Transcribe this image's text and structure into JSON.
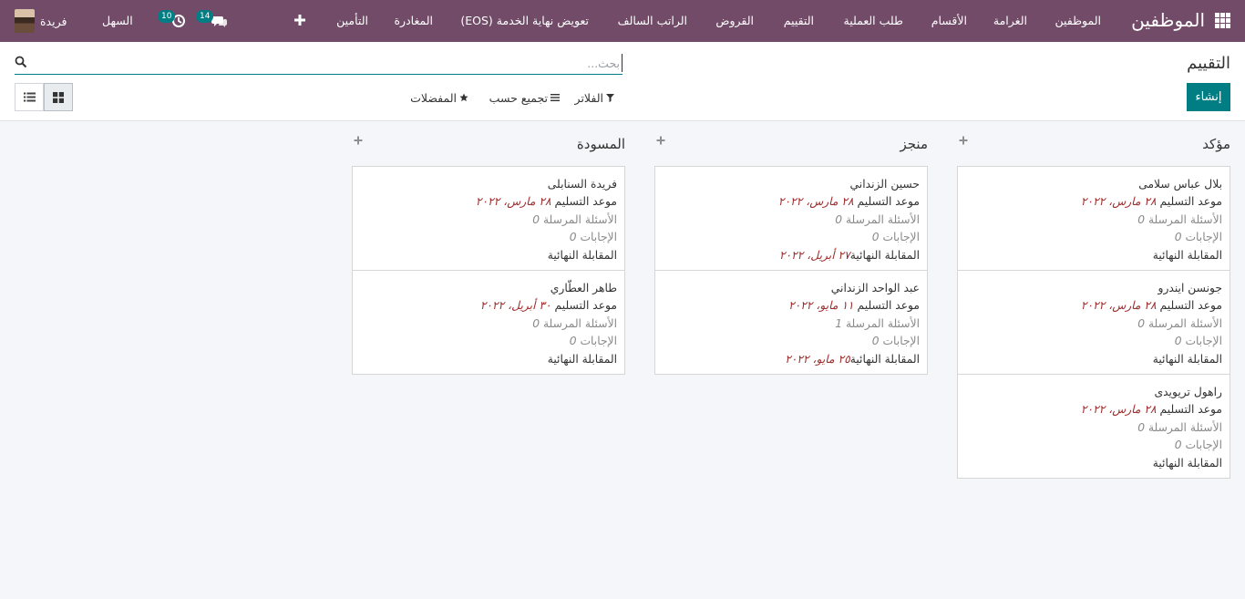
{
  "navbar": {
    "brand": "الموظفين",
    "menu": [
      {
        "label": "الموظفين"
      },
      {
        "label": "الغرامة"
      },
      {
        "label": "الأقسام"
      },
      {
        "label": "طلب العملية"
      },
      {
        "label": "التقييم"
      },
      {
        "label": "القروض"
      },
      {
        "label": "الراتب السالف"
      },
      {
        "label": "تعويض نهاية الخدمة (EOS)"
      },
      {
        "label": "المغادرة"
      },
      {
        "label": "التأمين"
      }
    ],
    "company": "السهل",
    "user_name": "فريدة",
    "messages_count": "14",
    "activities_count": "10",
    "accent_color": "#714b67"
  },
  "control_panel": {
    "breadcrumb": "التقييم",
    "create_label": "إنشاء",
    "search_placeholder": "بحث...",
    "filters_label": "الفلاتر",
    "group_by_label": "تجميع حسب",
    "favorites_label": "المفضلات",
    "primary_color": "#017e84"
  },
  "kanban": {
    "labels": {
      "deadline": "موعد التسليم",
      "questions_sent": "الأسئلة المرسلة",
      "answers": "الإجابات",
      "final_interview": "المقابلة النهائية"
    },
    "columns": [
      {
        "title": "مؤكد",
        "cards": [
          {
            "name": "بلال عباس سلامى",
            "deadline": "٢٨ مارس، ٢٠٢٢",
            "questions_sent": "0",
            "answers": "0",
            "final_interview": ""
          },
          {
            "name": "جونسن ايندرو",
            "deadline": "٢٨ مارس، ٢٠٢٢",
            "questions_sent": "0",
            "answers": "0",
            "final_interview": ""
          },
          {
            "name": "راهول تريويدى",
            "deadline": "٢٨ مارس، ٢٠٢٢",
            "questions_sent": "0",
            "answers": "0",
            "final_interview": ""
          }
        ]
      },
      {
        "title": "منجز",
        "cards": [
          {
            "name": "حسين الزنداني",
            "deadline": "٢٨ مارس، ٢٠٢٢",
            "questions_sent": "0",
            "answers": "0",
            "final_interview": "٢٧ أبريل، ٢٠٢٢"
          },
          {
            "name": "عبد الواحد الزنداني",
            "deadline": "١١ مايو، ٢٠٢٢",
            "questions_sent": "1",
            "answers": "0",
            "final_interview": "٢٥ مايو، ٢٠٢٢"
          }
        ]
      },
      {
        "title": "المسودة",
        "cards": [
          {
            "name": "فريدة السنابلى",
            "deadline": "٢٨ مارس، ٢٠٢٢",
            "questions_sent": "0",
            "answers": "0",
            "final_interview": ""
          },
          {
            "name": "طاهر العطّاري",
            "deadline": "٣٠ أبريل، ٢٠٢٢",
            "questions_sent": "0",
            "answers": "0",
            "final_interview": ""
          }
        ]
      }
    ]
  }
}
